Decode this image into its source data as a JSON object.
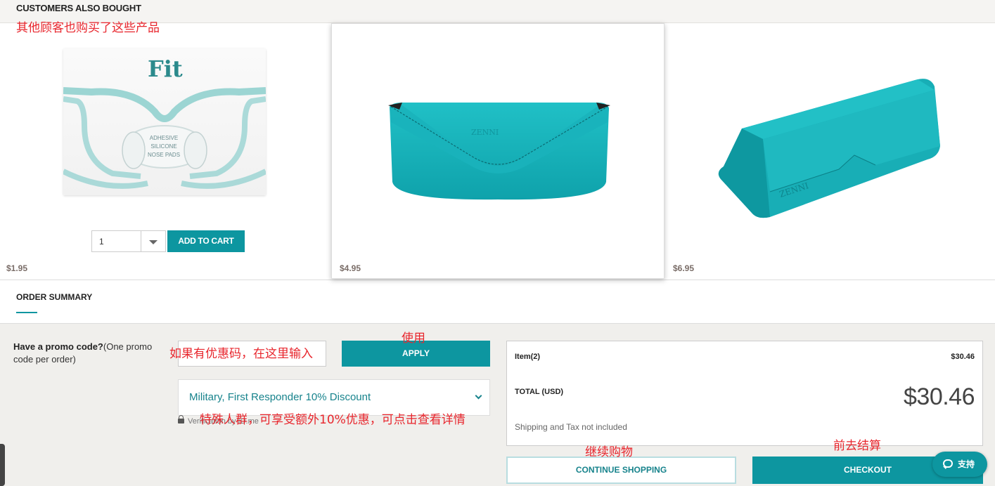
{
  "header": {
    "title": "CUSTOMERS ALSO BOUGHT"
  },
  "notes": {
    "also_bought": "其他顾客也购买了这些产品",
    "apply": "使用",
    "promo_input": "如果有优惠码，在这里输入",
    "discount": "特殊人群，可享受额外10%优惠，可点击查看详情",
    "continue": "继续购物",
    "checkout": "前去结算"
  },
  "products": [
    {
      "image": "adhesive-silicone-nose-pads-box",
      "box_brand": "Fit",
      "box_text": [
        "ADHESIVE",
        "SILICONE",
        "NOSE PADS"
      ],
      "price": "$1.95",
      "quantity": "1",
      "add_to_cart": "ADD TO CART"
    },
    {
      "image": "teal-leather-glasses-pouch",
      "imprint": "ZENNI",
      "price": "$4.95"
    },
    {
      "image": "teal-folding-glasses-case",
      "imprint": "ZENNI",
      "price": "$6.95"
    }
  ],
  "order_summary": {
    "title": "ORDER SUMMARY",
    "promo_question_bold": "Have a promo code?",
    "promo_question_rest": "(One promo code per order)",
    "promo_placeholder": "",
    "apply_label": "APPLY",
    "discount_option": "Military, First Responder 10% Discount",
    "verify_text": "Verification by ID.me",
    "items_label": "Item(2)",
    "items_value": "$30.46",
    "total_label": "TOTAL (USD)",
    "total_value": "$30.46",
    "shipping_note": "Shipping and Tax not included",
    "continue_label": "CONTINUE SHOPPING",
    "checkout_label": "CHECKOUT",
    "support_label": "支持"
  },
  "colors": {
    "accent": "#0d96a0",
    "note": "#e8262d",
    "product_teal": "#1bb0b8"
  }
}
